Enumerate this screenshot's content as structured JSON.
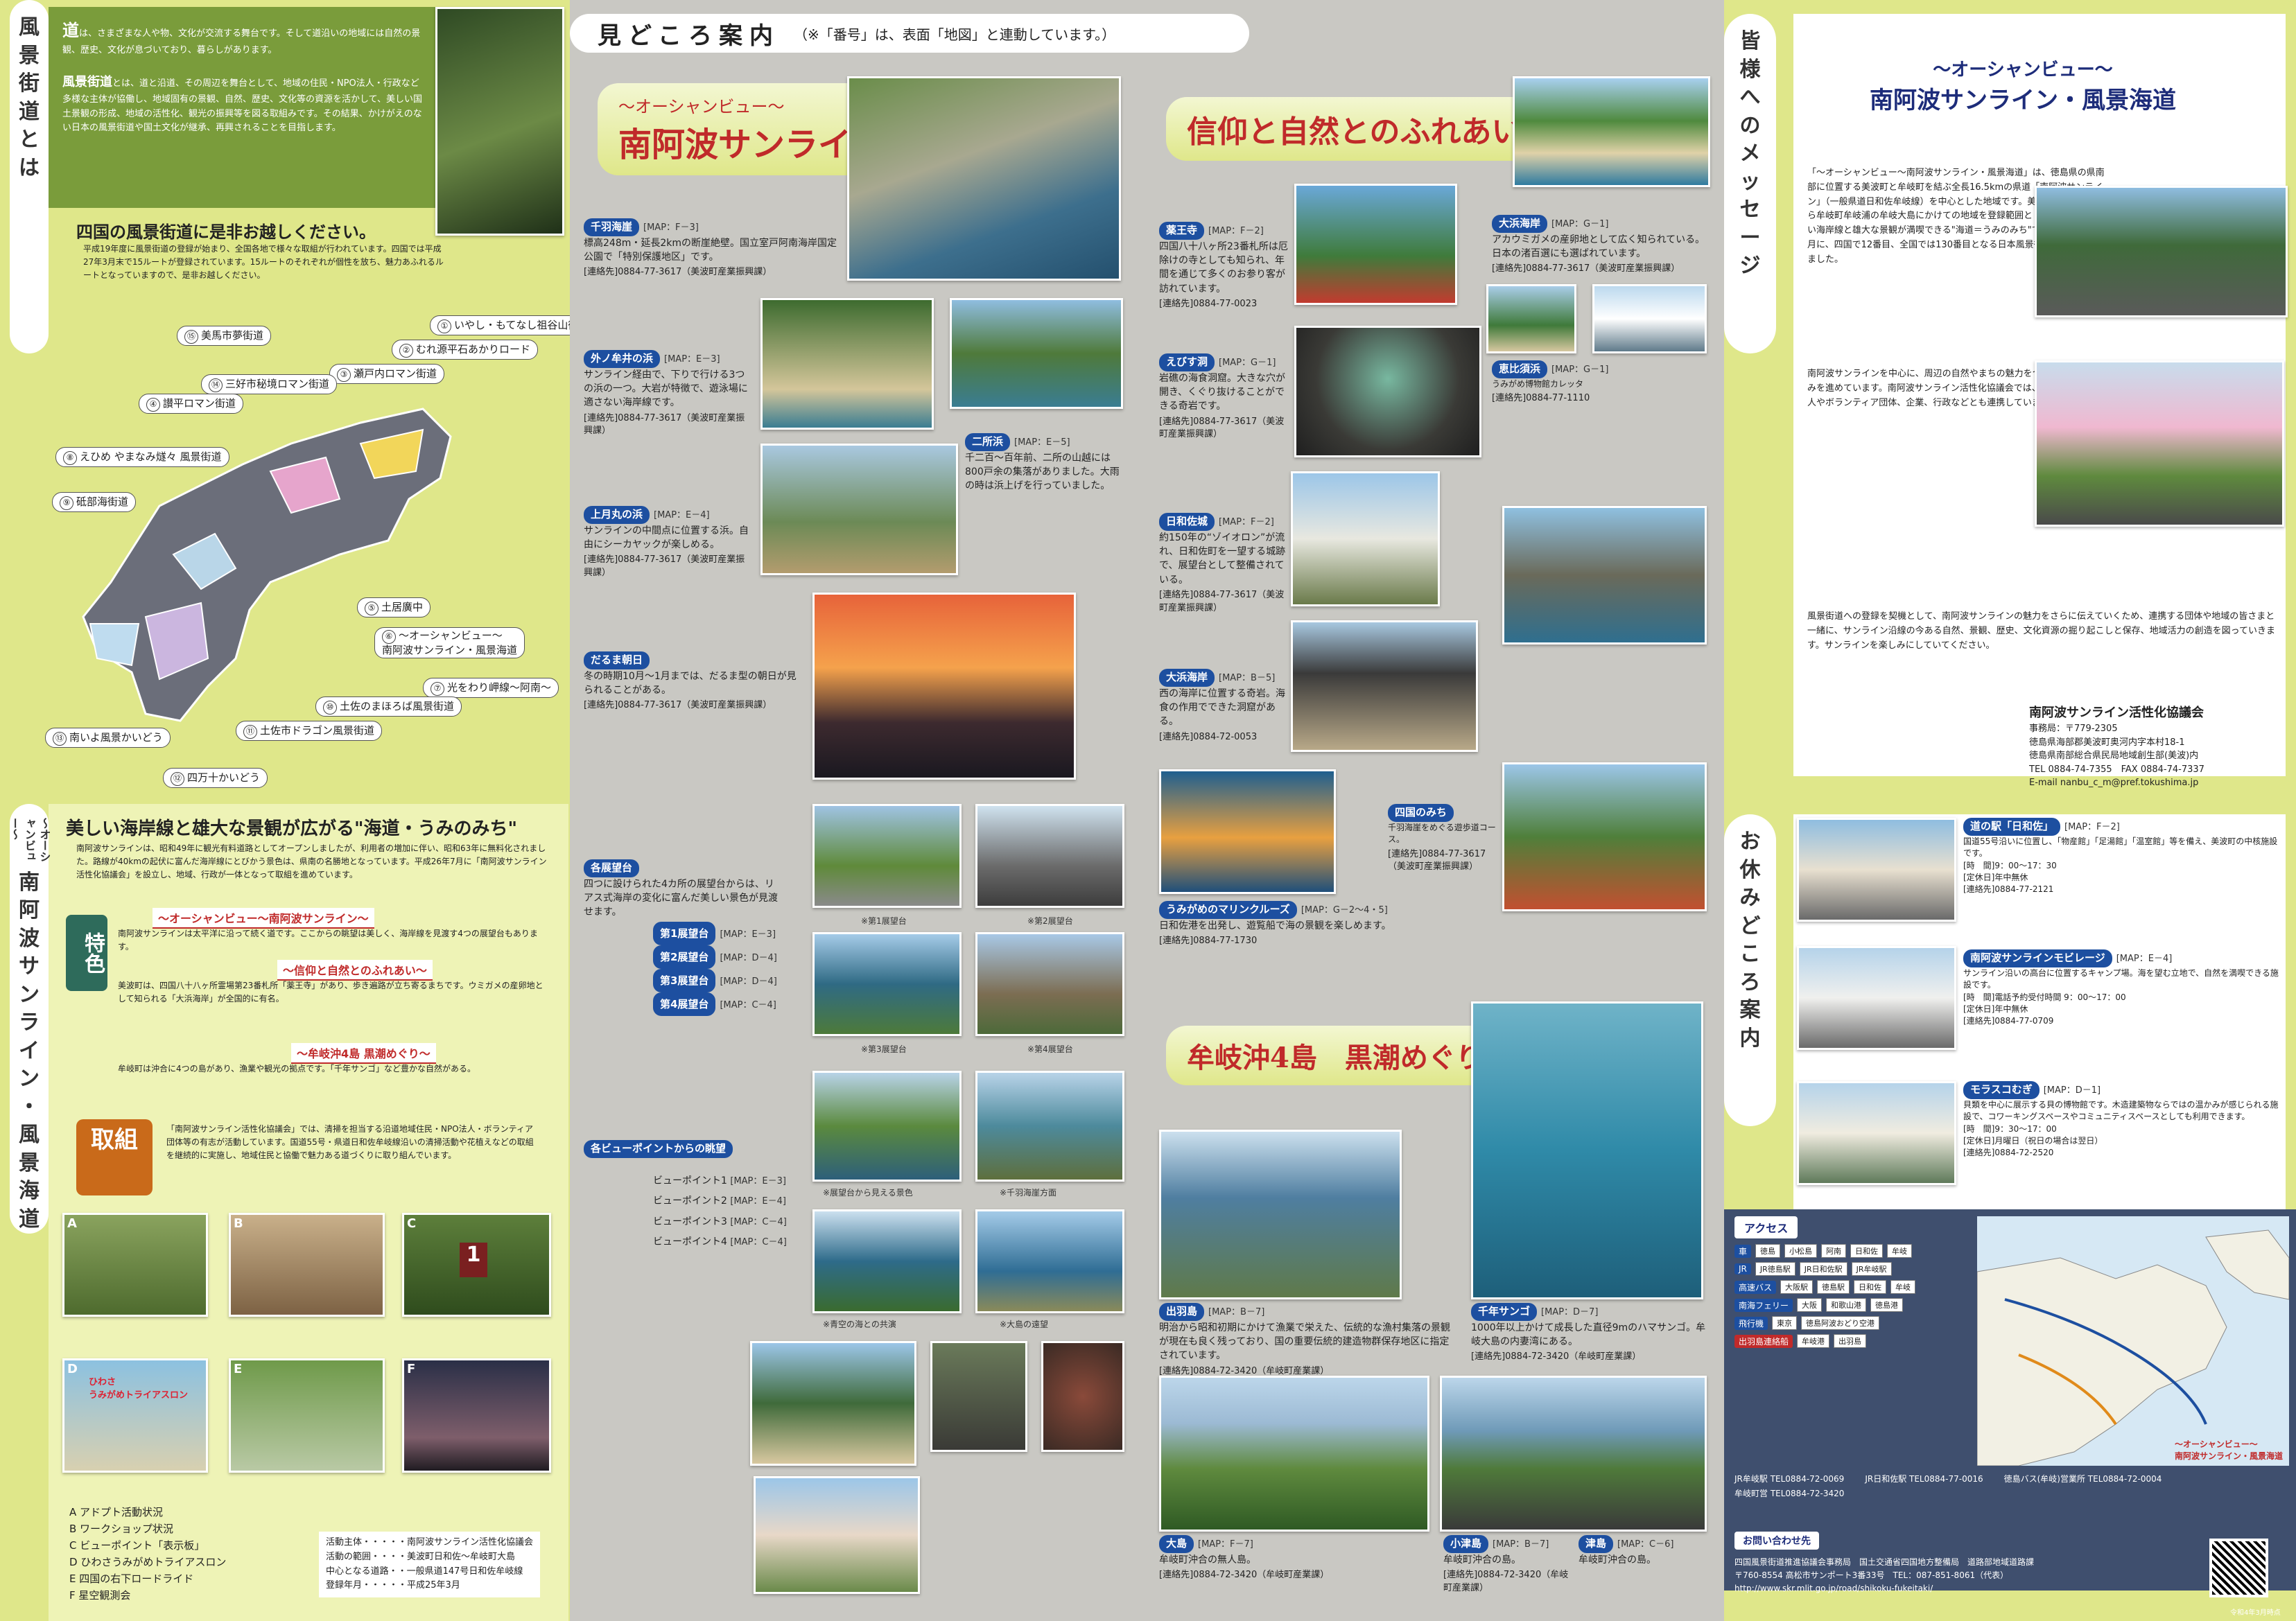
{
  "left": {
    "vbar_top": [
      "風",
      "景",
      "街",
      "道",
      "と",
      "は"
    ],
    "intro_heading_1": "道",
    "intro_text_1": "は、さまざまな人や物、文化が交流する舞台です。そして道沿いの地域には自然の景観、歴史、文化が息づいており、暮らしがあります。",
    "intro_heading_2": "風景街道",
    "intro_text_2": "とは、道と沿道、その周辺を舞台として、地域の住民・NPO法人・行政など多様な主体が協働し、地域固有の景観、自然、歴史、文化等の資源を活かして、美しい国土景観の形成、地域の活性化、観光の振興等を図る取組みです。その結果、かけがえのない日本の風景街道や国土文化が継承、再興されることを目指します。",
    "visit_title": "四国の風景街道に是非お越しください。",
    "visit_text": "平成19年度に風景街道の登録が始まり、全国各地で様々な取組が行われています。四国では平成27年3月末で15ルートが登録されています。15ルートのそれぞれが個性を放ち、魅力あふれるルートとなっていますので、是非お越しください。",
    "routes": [
      {
        "num": "①",
        "name": "いやし・もてなし祖谷山街道"
      },
      {
        "num": "②",
        "name": "むれ源平石あかりロード"
      },
      {
        "num": "③",
        "name": "瀬戸内ロマン街道"
      },
      {
        "num": "④",
        "name": "讃平ロマン街道"
      },
      {
        "num": "⑤",
        "name": "土居廣中"
      },
      {
        "num": "⑥",
        "name": "南阿波サンライン・風景海道"
      },
      {
        "num": "⑦",
        "name": "光をわり岬線～阿南～"
      },
      {
        "num": "⑧",
        "name": "えひめ やまなみ燧々 風景街道"
      },
      {
        "num": "⑨",
        "name": "砥部海街道"
      },
      {
        "num": "⑩",
        "name": "土佐のまほろば風景街道"
      },
      {
        "num": "⑪",
        "name": "土佐市ドラゴン風景街道"
      },
      {
        "num": "⑫",
        "name": "四万十かいどう"
      },
      {
        "num": "⑬",
        "name": "南いよ風景かいどう"
      },
      {
        "num": "⑭",
        "name": "三好市秘境ロマン街道"
      },
      {
        "num": "⑮",
        "name": "美馬市夢街道"
      }
    ],
    "route_label_sunline": "～オーシャンビュー～\n南阿波サンライン・風景海道",
    "vbar_bottom_sub": "～オーシャンビュー～",
    "vbar_bottom": [
      "南",
      "阿",
      "波",
      "サ",
      "ン",
      "ラ",
      "イ",
      "ン",
      "・",
      "風",
      "景",
      "海",
      "道"
    ],
    "coast_title": "美しい海岸線と雄大な景観が広がる\"海道・うみのみち\"",
    "coast_text": "南阿波サンラインは、昭和49年に観光有料道路としてオープンしましたが、利用者の増加に伴い、昭和63年に無料化されました。路線が40kmの起伏に富んだ海岸線にとびかう景色は、県南の名勝地となっています。平成26年7月に「南阿波サンライン活性化協議会」を設立し、地域、行政が一体となって取組を進めています。",
    "feature_badge": "特色",
    "features": [
      {
        "head": "～オーシャンビュー～南阿波サンライン～",
        "text": "南阿波サンラインは太平洋に沿って続く道です。ここからの眺望は美しく、海岸線を見渡す4つの展望台もあります。"
      },
      {
        "head": "～信仰と自然とのふれあい～",
        "text": "美波町は、四国八十八ヶ所霊場第23番札所「薬王寺」があり、歩き遍路が立ち寄るまちです。ウミガメの産卵地として知られる「大浜海岸」が全国的に有名。"
      },
      {
        "head": "～牟岐沖4島 黒潮めぐり～",
        "text": "牟岐町は沖合に4つの島があり、漁業や観光の拠点です。「千年サンゴ」など豊かな自然がある。"
      }
    ],
    "effort_badge": "取組",
    "effort_text": "「南阿波サンライン活性化協議会」では、清掃を担当する沿道地域住民・NPO法人・ボランティア団体等の有志が活動しています。国道55号・県道日和佐牟岐線沿いの清掃活動や花植えなどの取組を継続的に実施し、地域住民と協働で魅力ある道づくりに取り組んでいます。",
    "photo_letters": [
      "A",
      "B",
      "C",
      "D",
      "E",
      "F"
    ],
    "legend": [
      "A アドプト活動状況",
      "B ワークショップ状況",
      "C ビューポイント「表示板」",
      "D ひわさうみがめトライアスロン",
      "E 四国の右下ロードライド",
      "F 星空観測会"
    ],
    "org": [
      "活動主体・・・・・南阿波サンライン活性化協議会",
      "活動の範囲・・・・美波町日和佐～牟岐町大島",
      "中心となる道路・・一般県道147号日和佐牟岐線",
      "登録年月・・・・・平成25年3月"
    ],
    "d_sign_1": "ひわさ",
    "d_sign_2": "うみがめトライアスロン",
    "c_sign": "1"
  },
  "middle": {
    "section_title": "見どころ案内",
    "section_note": "（※「番号」は、表面「地図」と連動しています。）",
    "sunline_sub": "～オーシャンビュー～",
    "sunline_main": "南阿波サンライン",
    "faith_title": "信仰と自然とのふれあい",
    "islands_title": "牟岐沖4島　黒潮めぐり",
    "spots": [
      {
        "num": "1",
        "name": "千羽海崖",
        "map": "[MAP：F－3]",
        "text": "標高248m・延長2kmの断崖絶壁。国立室戸阿南海岸国定公園で「特別保護地区」です。",
        "contact": "[連絡先]0884-77-3617（美波町産業振興課）"
      },
      {
        "num": "2",
        "name": "外ノ牟井の浜",
        "map": "[MAP：E－3]",
        "text": "サンライン経由で、下りで行ける3つの浜の一つ。大岩が特徴で、遊泳場に適さない海岸線です。",
        "contact": "[連絡先]0884-77-3617（美波町産業振興課）"
      },
      {
        "num": "3",
        "name": "二所浜",
        "map": "[MAP：E－5]",
        "text": "千二百～百年前、二所の山越には800戸余の集落がありました。大雨の時は浜上げを行っていました。",
        "contact": "[連絡先]0884-77-3617（美波町産業振興課）"
      },
      {
        "num": "4",
        "name": "上月丸の浜",
        "map": "[MAP：E－4]",
        "text": "サンラインの中間点に位置する浜。自由にシーカヤックが楽しめる。",
        "contact": "[連絡先]0884-77-3617（美波町産業振興課）"
      },
      {
        "num": "5",
        "name": "だるま朝日",
        "map": "",
        "text": "冬の時期10月～1月までは、だるま型の朝日が見られることがある。",
        "contact": "[連絡先]0884-77-3617（美波町産業振興課）"
      },
      {
        "num": "6",
        "name": "薬王寺",
        "map": "[MAP：F－2]",
        "text": "四国八十八ヶ所23番札所は厄除けの寺としても知られ、年間を通じて多くのお参り客が訪れています。",
        "contact": "[連絡先]0884-77-0023"
      },
      {
        "num": "7",
        "name": "えびす洞",
        "map": "[MAP：G－1]",
        "text": "岩礁の海食洞窟。大きな穴が開き、くぐり抜けることができる奇岩です。",
        "contact": "[連絡先]0884-77-3617（美波町産業振興課）"
      },
      {
        "num": "8",
        "name": "日和佐城",
        "map": "[MAP：F－2]",
        "text": "約150年の“ゾイオロン”が流れ、日和佐町を一望する城跡で、展望台として整備されている。",
        "contact": "[連絡先]0884-77-3617（美波町産業振興課）"
      },
      {
        "num": "9",
        "name": "大浜海岸",
        "map": "[MAP：G－1]",
        "text": "アカウミガメの産卵地として広く知られている。日本の渚百選にも選ばれています。",
        "contact": "[連絡先]0884-77-3617（美波町産業振興課）"
      },
      {
        "num": "10",
        "name": "恵比須浜",
        "map": "[MAP：G－1]",
        "text": "うみがめ博物館カレッタ",
        "contact": "[連絡先]0884-77-1110"
      },
      {
        "num": "11",
        "name": "大浜海岸",
        "map": "[MAP：B－5]",
        "text": "西の海岸に位置する奇岩。海食の作用でできた洞窟がある。",
        "contact": "[連絡先]0884-72-0053"
      },
      {
        "num": "12",
        "name": "うみがめのマリンクルーズ",
        "map": "[MAP：G－2～4・5]",
        "text": "日和佐港を出発し、遊覧船で海の景観を楽しめます。",
        "contact": "[連絡先]0884-77-1730"
      },
      {
        "num": "13",
        "name": "四国のみち",
        "map": "",
        "text": "千羽海崖をめぐる遊歩道コース。",
        "contact": "[連絡先]0884-77-3617（美波町産業振興課）"
      },
      {
        "num": "14",
        "name": "出羽島",
        "map": "[MAP：B－7]",
        "text": "明治から昭和初期にかけて漁業で栄えた、伝統的な漁村集落の景観が現在も良く残っており、国の重要伝統的建造物群保存地区に指定されています。",
        "contact": "[連絡先]0884-72-3420（牟岐町産業課）"
      },
      {
        "num": "15",
        "name": "千年サンゴ",
        "map": "[MAP：D－7]",
        "text": "1000年以上かけて成長した直径9mのハマサンゴ。牟岐大島の内妻湾にある。",
        "contact": "[連絡先]0884-72-3420（牟岐町産業課）"
      },
      {
        "num": "16",
        "name": "大島",
        "map": "[MAP：F－7]",
        "text": "牟岐町沖合の無人島。",
        "contact": "[連絡先]0884-72-3420（牟岐町産業課）"
      },
      {
        "num": "17",
        "name": "小津島",
        "map": "[MAP：B－7]",
        "text": "牟岐町沖合の島。",
        "contact": "[連絡先]0884-72-3420（牟岐町産業課）"
      },
      {
        "num": "18",
        "name": "津島",
        "map": "[MAP：C－6]",
        "text": "牟岐町沖合の島。",
        "contact": "[連絡先]0884-72-3420（牟岐町産業課）"
      }
    ],
    "observatory_head": "各展望台",
    "observatory_text": "四つに設けられた4カ所の展望台からは、リアス式海岸の変化に富んだ美しい景色が見渡せます。",
    "observatories": [
      "第1展望台",
      "第2展望台",
      "第3展望台",
      "第4展望台"
    ],
    "observatory_maps": [
      "[MAP：E－3]",
      "[MAP：D－4]",
      "[MAP：D－4]",
      "[MAP：C－4]"
    ],
    "obs_captions": [
      "※第1展望台",
      "※第2展望台",
      "※第3展望台",
      "※第4展望台"
    ],
    "viewpoint_head": "各ビューポイントからの眺望",
    "viewpoints": [
      "ビューポイント1",
      "ビューポイント2",
      "ビューポイント3",
      "ビューポイント4"
    ],
    "viewpoint_maps": [
      "[MAP：E－3]",
      "[MAP：E－4]",
      "[MAP：C－4]",
      "[MAP：C－4]"
    ],
    "vp_captions": [
      "※展望台から見える景色",
      "※千羽海崖方面",
      "※青空の海との共演",
      "※大島の遠望"
    ]
  },
  "right": {
    "vbar_top": [
      "皆",
      "様",
      "へ",
      "の",
      "メ",
      "ッ",
      "セ",
      "ー",
      "ジ"
    ],
    "msg_sub": "～オーシャンビュー～",
    "msg_title": "南阿波サンライン・風景海道",
    "msg_text_1": "「～オーシャンビュー～南阿波サンライン・風景海道」は、徳島県の県南部に位置する美波町と牟岐町を結ぶ全長16.5kmの県道「南阿波サンライン」（一般県道日和佐牟岐線）を中心とした地域です。美波町恵比須浜から牟岐町牟岐浦の牟岐大島にかけての地域を登録範囲としています。美しい海岸線と雄大な景観が満喫できる\"海道＝うみのみち\"です。平成25年3月に、四国で12番目、全国では130番目となる日本風景街道に登録されました。",
    "msg_text_2": "南阿波サンラインを中心に、周辺の自然やまちの魅力をつなぐ取り組みを進めています。南阿波サンライン活性化協議会では、地元NPO法人やボランティア団体、企業、行政などとも連携しています。",
    "msg_text_3": "風景街道への登録を契機として、南阿波サンラインの魅力をさらに伝えていくため、連携する団体や地域の皆さまと一緒に、サンライン沿線の今ある自然、景観、歴史、文化資源の掘り起こしと保存、地域活力の創造を図っていきます。サンラインを楽しみにしていてください。",
    "council_name": "南阿波サンライン活性化協議会",
    "council_office": "事務局：〒779-2305",
    "council_addr": "徳島県海部郡美波町奥河内字本村18-1",
    "council_addr2": "徳島県南部総合県民局地域創生部(美波)内",
    "council_tel": "TEL 0884-74-7355　FAX 0884-74-7337",
    "council_email": "E-mail nanbu_c_m@pref.tokushima.jp",
    "vbar_rest": [
      "お",
      "休",
      "み",
      "ど",
      "こ",
      "ろ",
      "案",
      "内"
    ],
    "rests": [
      {
        "num": "1",
        "name": "道の駅「日和佐」",
        "map": "[MAP：F－2]",
        "text": "国道55号沿いに位置し、「物産館」「足湯館」「温室館」等を備え、美波町の中核施設です。",
        "hours": "[時　間]9：00～17：30",
        "closed": "[定休日]年中無休",
        "contact": "[連絡先]0884-77-2121"
      },
      {
        "num": "2",
        "name": "南阿波サンラインモビレージ",
        "map": "[MAP：E－4]",
        "text": "サンライン沿いの高台に位置するキャンプ場。海を望む立地で、自然を満喫できる施設です。",
        "hours": "[時　間]電話予約受付時間 9：00～17：00",
        "closed": "[定休日]年中無休",
        "contact": "[連絡先]0884-77-0709"
      },
      {
        "num": "3",
        "name": "モラスコむぎ",
        "map": "[MAP：D－1]",
        "text": "貝類を中心に展示する貝の博物館です。木造建築物ならではの温かみが感じられる施設で、コワーキングスペースやコミュニティスペースとしても利用できます。",
        "hours": "[時　間]9：30～17：00",
        "closed": "[定休日]月曜日（祝日の場合は翌日）",
        "contact": "[連絡先]0884-72-2520"
      }
    ],
    "access_head": "アクセス",
    "access_rows": [
      {
        "mode": "車",
        "stops": [
          "徳島",
          "小松島",
          "阿南",
          "日和佐",
          "牟岐"
        ]
      },
      {
        "mode": "JR",
        "stops": [
          "JR徳島駅",
          "JR日和佐駅",
          "JR牟岐駅"
        ]
      },
      {
        "mode": "高速バス",
        "stops": [
          "大阪駅",
          "徳島駅",
          "日和佐",
          "牟岐"
        ]
      },
      {
        "mode": "南海フェリー",
        "stops": [
          "大阪",
          "和歌山港",
          "徳島港"
        ]
      },
      {
        "mode": "飛行機",
        "stops": [
          "東京",
          "徳島阿波おどり空港"
        ]
      },
      {
        "mode": "出羽島連絡船",
        "stops": [
          "牟岐港",
          "出羽島"
        ]
      }
    ],
    "access_tel": [
      "JR牟岐駅 TEL0884-72-0069",
      "JR日和佐駅 TEL0884-77-0016",
      "徳島バス(牟岐)営業所 TEL0884-72-0004",
      "牟岐町営 TEL0884-72-3420"
    ],
    "map_label": "～オーシャンビュー～\n南阿波サンライン・風景海道",
    "inquiry_head": "お問い合わせ先",
    "inquiry_org": "四国風景街道推進協議会事務局　国土交通省四国地方整備局　道路部地域道路課",
    "inquiry_addr": "〒760-8554 高松市サンポート3番33号　TEL：087-851-8061（代表）",
    "inquiry_url": "http://www.skr.mlit.go.jp/road/shikoku-fukeitaki/",
    "issue_date": "令和4年3月時点"
  },
  "colors": {
    "accent_red": "#c02a2a",
    "navy": "#1d2c7a",
    "left_green": "#dfe78a"
  }
}
